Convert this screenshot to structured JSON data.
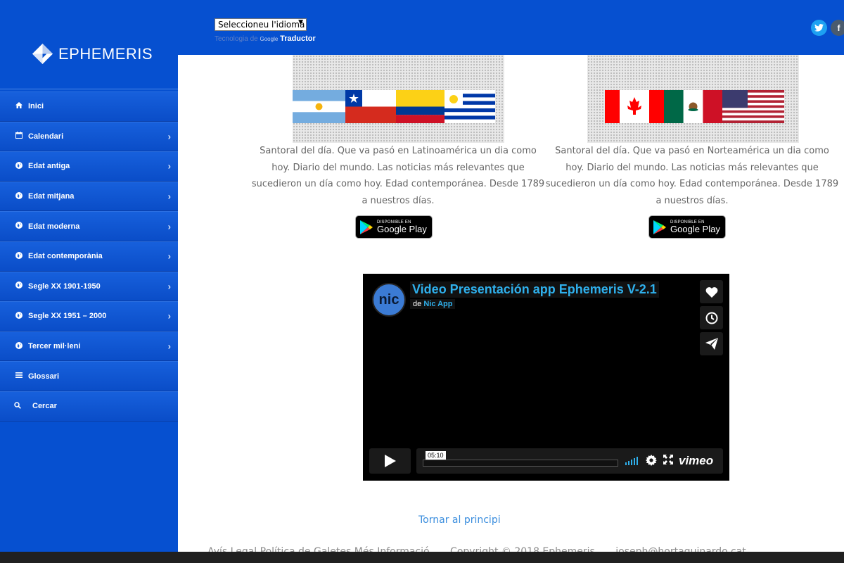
{
  "header": {
    "language_select": "Seleccioneu l'idioma",
    "powered_by": "Tecnologia de",
    "google": "Google",
    "translate": "Traductor"
  },
  "sidebar": {
    "brand": "EPHEMERIS",
    "items": [
      {
        "label": "Inici",
        "icon": "home-icon",
        "has_submenu": false
      },
      {
        "label": "Calendari",
        "icon": "calendar-icon",
        "has_submenu": true
      },
      {
        "label": "Edat antiga",
        "icon": "globe-icon",
        "has_submenu": true
      },
      {
        "label": "Edat mitjana",
        "icon": "globe-icon",
        "has_submenu": true
      },
      {
        "label": "Edat moderna",
        "icon": "globe-icon",
        "has_submenu": true
      },
      {
        "label": "Edat contemporània",
        "icon": "globe-icon",
        "has_submenu": true
      },
      {
        "label": "Segle XX 1901-1950",
        "icon": "globe-icon",
        "has_submenu": true
      },
      {
        "label": "Segle XX 1951 – 2000",
        "icon": "globe-icon",
        "has_submenu": true
      },
      {
        "label": "Tercer mil·leni",
        "icon": "globe-icon",
        "has_submenu": true
      },
      {
        "label": "Glossari",
        "icon": "list-icon",
        "has_submenu": false
      },
      {
        "label": "Cercar",
        "icon": "search-icon",
        "has_submenu": false
      }
    ]
  },
  "apps": [
    {
      "region": "latinoamerica",
      "flags": [
        "argentina",
        "chile",
        "colombia",
        "uruguay"
      ],
      "description": "Santoral del día. Que va pasó en Latinoamérica un dia como hoy. Diario del mundo. Las noticias más relevantes que sucedieron un día como hoy. Edad contemporánea. Desde 1789 a nuestros días.",
      "store_small": "DISPONIBLE EN",
      "store_big": "Google Play"
    },
    {
      "region": "norteamerica",
      "flags": [
        "canada",
        "mexico",
        "usa"
      ],
      "description": "Santoral del día. Que va pasó en Norteamérica un dia como hoy. Diario del mundo. Las noticias más relevantes que sucedieron un día como hoy. Edad contemporánea. Desde 1789 a nuestros días.",
      "store_small": "DISPONIBLE EN",
      "store_big": "Google Play"
    }
  ],
  "video": {
    "title": "Video Presentación app Ephemeris V-2.1",
    "by_prefix": "de",
    "author": "Nic App",
    "avatar_text": "nic",
    "time": "05:10",
    "logo": "vimeo"
  },
  "back_to_top": "Tornar al principi",
  "footer": {
    "links": "Avís Legal  Política de Galetes  Més Informació",
    "copyright": "Copyright © 2018 Ephemeris",
    "email": "joseph@hortaguinardo.cat"
  },
  "colors": {
    "primary": "#0650d0",
    "link": "#3b8ede",
    "vimeo_accent": "#2fb0ec"
  }
}
